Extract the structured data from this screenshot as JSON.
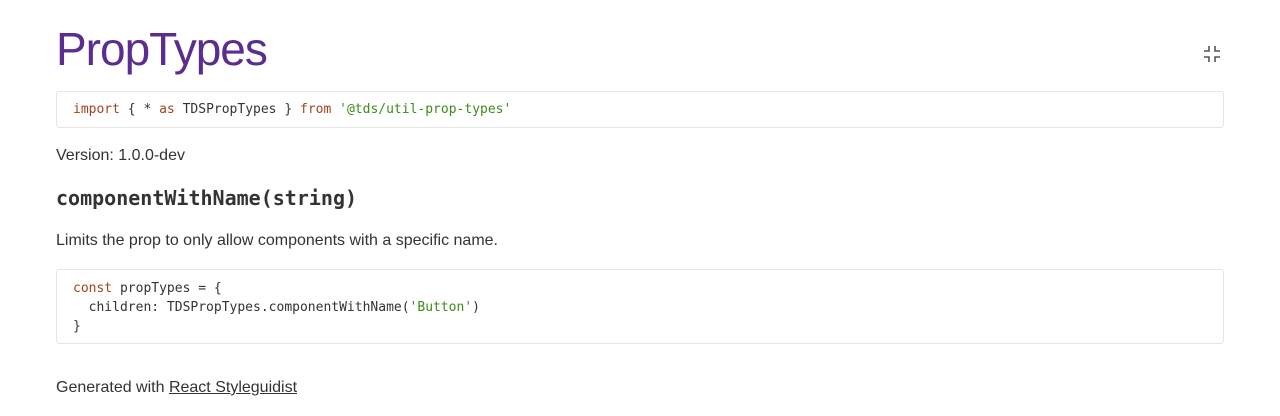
{
  "header": {
    "title": "PropTypes",
    "isolate_icon": "collapse-icon"
  },
  "import_code": {
    "kw_import": "import",
    "punct_open": " { * ",
    "kw_as": "as",
    "ident": " TDSPropTypes } ",
    "kw_from": "from",
    "space": " ",
    "module_string": "'@tds/util-prop-types'"
  },
  "version_text": "Version: 1.0.0-dev",
  "method": {
    "signature": "componentWithName(string)",
    "description": "Limits the prop to only allow components with a specific name."
  },
  "example_code": {
    "line1_kw": "const",
    "line1_rest": " propTypes = {",
    "line2_prefix": "  children: TDSPropTypes.componentWithName(",
    "line2_string": "'Button'",
    "line2_suffix": ")",
    "line3": "}"
  },
  "footer": {
    "prefix": "Generated with ",
    "link_text": "React Styleguidist"
  },
  "colors": {
    "title": "#5b2d8e",
    "keyword": "#a3431a",
    "string": "#3c8c1c",
    "border": "#e6e6e6"
  }
}
